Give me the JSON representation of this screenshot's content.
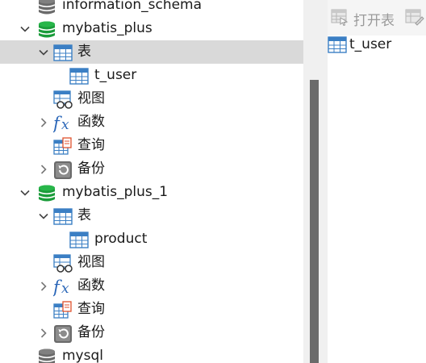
{
  "tree": [
    {
      "label": "information_schema",
      "icon": "database-gray-icon",
      "expanded": null
    },
    {
      "label": "mybatis_plus",
      "icon": "database-green-icon",
      "expanded": true
    },
    {
      "label": "表",
      "icon": "table-folder-icon",
      "expanded": true,
      "selected": true
    },
    {
      "label": "t_user",
      "icon": "table-icon",
      "expanded": null
    },
    {
      "label": "视图",
      "icon": "view-icon",
      "expanded": null
    },
    {
      "label": "函数",
      "icon": "function-icon",
      "expanded": false
    },
    {
      "label": "查询",
      "icon": "query-icon",
      "expanded": null
    },
    {
      "label": "备份",
      "icon": "backup-icon",
      "expanded": false
    },
    {
      "label": "mybatis_plus_1",
      "icon": "database-green-icon",
      "expanded": true
    },
    {
      "label": "表",
      "icon": "table-folder-icon",
      "expanded": true
    },
    {
      "label": "product",
      "icon": "table-icon",
      "expanded": null
    },
    {
      "label": "视图",
      "icon": "view-icon",
      "expanded": null
    },
    {
      "label": "函数",
      "icon": "function-icon",
      "expanded": false
    },
    {
      "label": "查询",
      "icon": "query-icon",
      "expanded": null
    },
    {
      "label": "备份",
      "icon": "backup-icon",
      "expanded": false
    },
    {
      "label": "mysql",
      "icon": "database-gray-icon",
      "expanded": null
    }
  ],
  "toolbar": {
    "open_table_label": "打开表"
  },
  "objects": [
    {
      "label": "t_user",
      "icon": "table-icon"
    }
  ],
  "colors": {
    "selected_row": "#d9d9d9",
    "db_green": "#1a9c3a",
    "table_blue": "#3b7fc4",
    "scrollbar_thumb": "#6b6b6b"
  }
}
